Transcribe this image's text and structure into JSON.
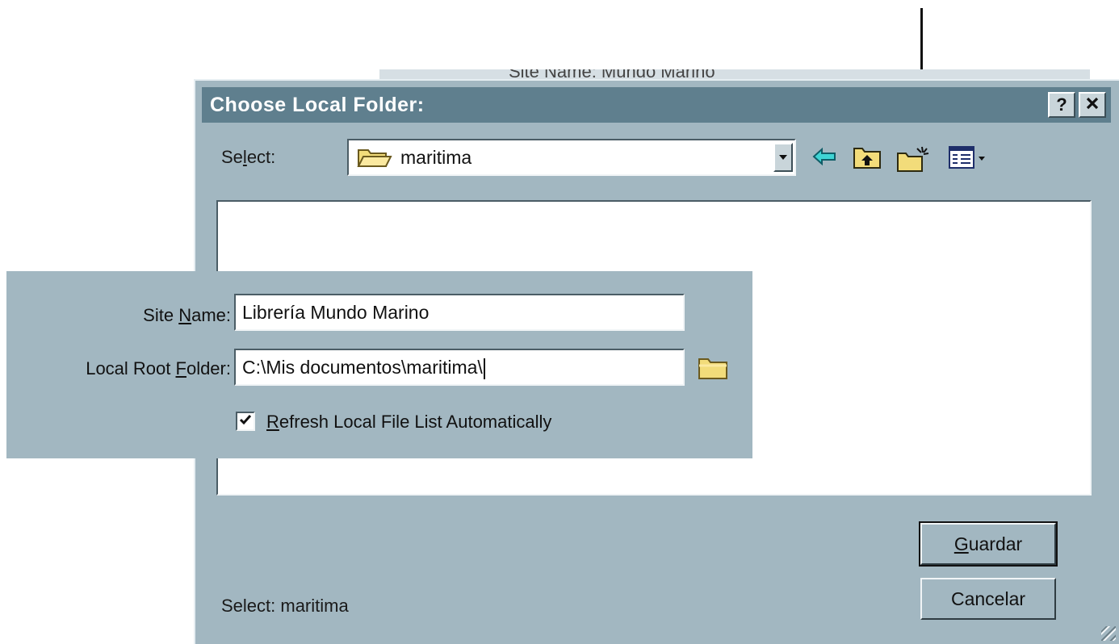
{
  "dialog": {
    "title": "Choose Local Folder:",
    "help_button": "?",
    "close_button": "✕",
    "select": {
      "label_pre": "Se",
      "label_ul": "l",
      "label_post": "ect:",
      "value": "maritima"
    },
    "toolbar": {
      "back_icon": "back-arrow-icon",
      "up_icon": "up-folder-icon",
      "new_folder_icon": "new-folder-icon",
      "view_icon": "view-menu-icon"
    },
    "buttons": {
      "guardar_ul": "G",
      "guardar_rest": "uardar",
      "cancelar": "Cancelar"
    },
    "status": "Select: maritima"
  },
  "overlay": {
    "site_name_label_pre": "Site ",
    "site_name_label_ul": "N",
    "site_name_label_post": "ame:",
    "site_name_value": "Librería Mundo Marino",
    "local_root_label_pre": "Local Root ",
    "local_root_label_ul": "F",
    "local_root_label_post": "older:",
    "local_root_value": "C:\\Mis documentos\\maritima\\",
    "refresh_checked": true,
    "refresh_label_ul": "R",
    "refresh_label_rest": "efresh Local File List Automatically"
  },
  "background_window": {
    "title": "Site Name: Mundo Marino"
  },
  "colors": {
    "dialog_bg": "#a2b7c1",
    "titlebar": "#5f7f8e",
    "folder_yellow": "#f2dc7a"
  }
}
